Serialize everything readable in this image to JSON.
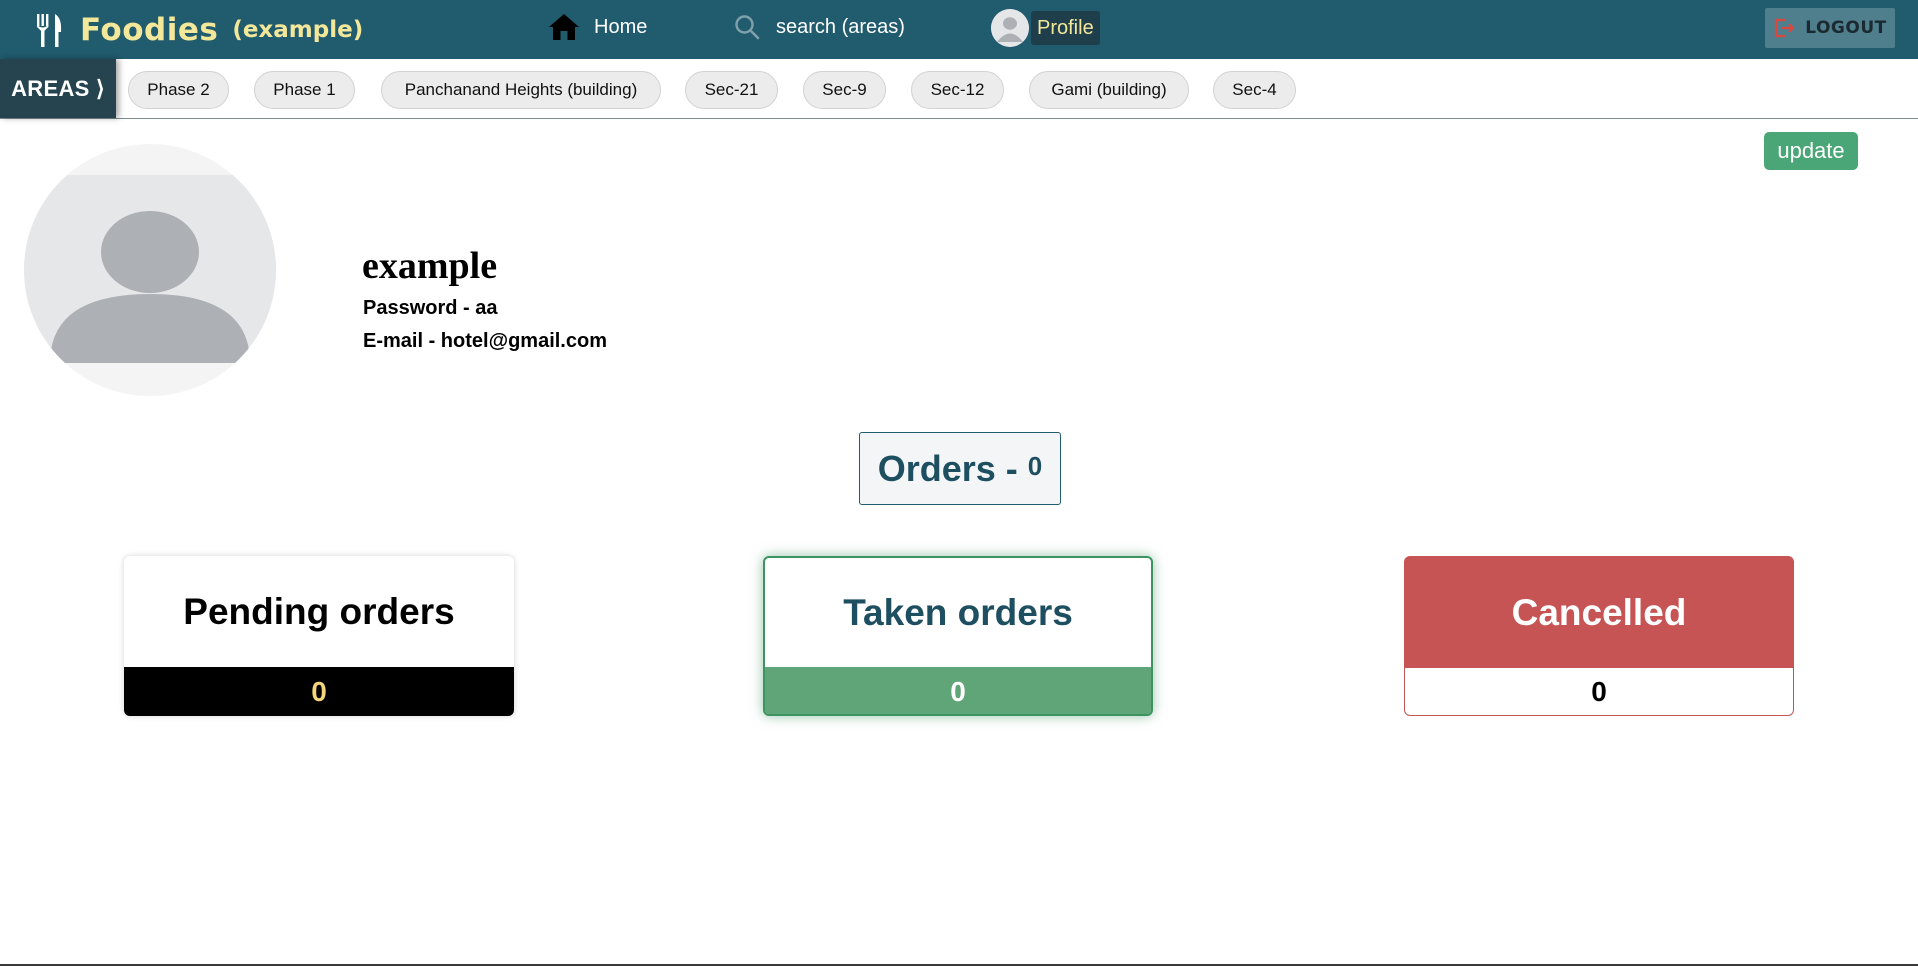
{
  "navbar": {
    "brand_name": "Foodies",
    "brand_sub": "(example)",
    "home_label": "Home",
    "search_label": "search (areas)",
    "profile_label": "Profile",
    "logout_label": "LOGOUT",
    "icons": [
      "fork-knife-icon",
      "home-icon",
      "search-icon",
      "avatar-icon",
      "logout-icon"
    ],
    "colors": {
      "bar": "#215b6e",
      "brand": "#f3e79a"
    }
  },
  "areas": {
    "label": "AREAS ⟩",
    "items": [
      "Phase 2",
      "Phase 1",
      "Panchanand Heights (building)",
      "Sec-21",
      "Sec-9",
      "Sec-12",
      "Gami (building)",
      "Sec-4"
    ]
  },
  "profile": {
    "update_label": "update",
    "name": "example",
    "password_line": "Password - aa",
    "email_line": "E-mail - hotel@gmail.com"
  },
  "orders": {
    "label": "Orders -",
    "count": "0",
    "cards": {
      "pending": {
        "title": "Pending orders",
        "count": "0"
      },
      "taken": {
        "title": "Taken orders",
        "count": "0"
      },
      "cancelled": {
        "title": "Cancelled",
        "count": "0"
      }
    },
    "colors": {
      "taken": "#5fa577",
      "cancelled": "#c75454",
      "pending_count": "#f3d57a"
    }
  }
}
